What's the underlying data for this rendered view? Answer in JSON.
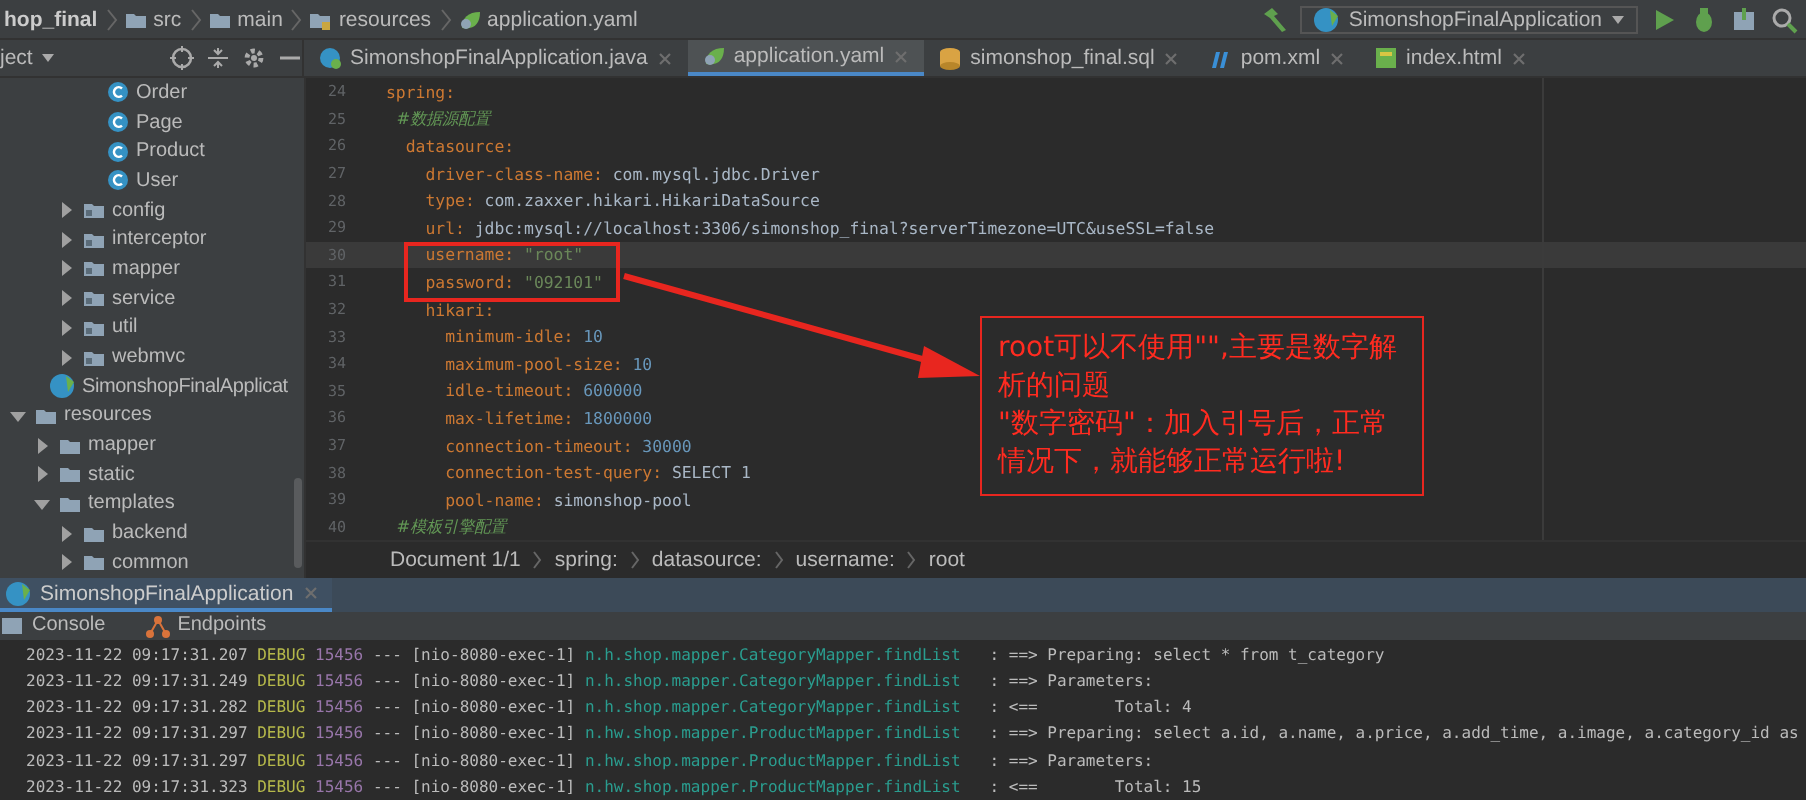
{
  "navbar": {
    "crumbs": [
      {
        "label": "hop_final",
        "kind": "project"
      },
      {
        "label": "src",
        "kind": "folder"
      },
      {
        "label": "main",
        "kind": "folder"
      },
      {
        "label": "resources",
        "kind": "resources"
      },
      {
        "label": "application.yaml",
        "kind": "yaml"
      }
    ],
    "run_config": "SimonshopFinalApplication"
  },
  "project_panel": {
    "title": "ject"
  },
  "tabs": [
    {
      "label": "SimonshopFinalApplication.java",
      "kind": "java",
      "selected": false
    },
    {
      "label": "application.yaml",
      "kind": "yaml",
      "selected": true
    },
    {
      "label": "simonshop_final.sql",
      "kind": "sql",
      "selected": false
    },
    {
      "label": "pom.xml",
      "kind": "pom",
      "selected": false
    },
    {
      "label": "index.html",
      "kind": "html",
      "selected": false
    }
  ],
  "tree": [
    {
      "label": "Order",
      "kind": "class"
    },
    {
      "label": "Page",
      "kind": "class"
    },
    {
      "label": "Product",
      "kind": "class"
    },
    {
      "label": "User",
      "kind": "class"
    },
    {
      "label": "config",
      "kind": "package",
      "expanded": false
    },
    {
      "label": "interceptor",
      "kind": "package",
      "expanded": false
    },
    {
      "label": "mapper",
      "kind": "package",
      "expanded": false
    },
    {
      "label": "service",
      "kind": "package",
      "expanded": false
    },
    {
      "label": "util",
      "kind": "package",
      "expanded": false
    },
    {
      "label": "webmvc",
      "kind": "package",
      "expanded": false
    },
    {
      "label": "SimonshopFinalApplicat",
      "kind": "app"
    },
    {
      "label": "resources",
      "kind": "folder",
      "expanded": true,
      "children": [
        {
          "label": "mapper",
          "kind": "folder",
          "expanded": false
        },
        {
          "label": "static",
          "kind": "folder",
          "expanded": false
        },
        {
          "label": "templates",
          "kind": "folder",
          "expanded": true,
          "children": [
            {
              "label": "backend",
              "kind": "folder",
              "expanded": false
            },
            {
              "label": "common",
              "kind": "folder",
              "expanded": false
            }
          ]
        }
      ]
    }
  ],
  "editor": {
    "lines": [
      {
        "number": "24",
        "current": false,
        "tokens": [
          {
            "kind": "key",
            "text": "spring"
          },
          {
            "kind": "punct",
            "text": ":"
          }
        ]
      },
      {
        "number": "25",
        "current": false,
        "tokens": [
          {
            "kind": "comment",
            "text": "  #数据源配置"
          }
        ]
      },
      {
        "number": "26",
        "current": false,
        "tokens": [
          {
            "kind": "key",
            "text": "  datasource"
          },
          {
            "kind": "punct",
            "text": ":"
          }
        ]
      },
      {
        "number": "27",
        "current": false,
        "tokens": [
          {
            "kind": "key",
            "text": "    driver-class-name"
          },
          {
            "kind": "punct",
            "text": ": "
          },
          {
            "kind": "plain",
            "text": "com.mysql.jdbc.Driver"
          }
        ]
      },
      {
        "number": "28",
        "current": false,
        "tokens": [
          {
            "kind": "key",
            "text": "    type"
          },
          {
            "kind": "punct",
            "text": ": "
          },
          {
            "kind": "plain",
            "text": "com.zaxxer.hikari.HikariDataSource"
          }
        ]
      },
      {
        "number": "29",
        "current": false,
        "tokens": [
          {
            "kind": "key",
            "text": "    url"
          },
          {
            "kind": "punct",
            "text": ": "
          },
          {
            "kind": "plain",
            "text": "jdbc:mysql://localhost:3306/simonshop_final?serverTimezone=UTC&useSSL=false"
          }
        ]
      },
      {
        "number": "30",
        "current": true,
        "tokens": [
          {
            "kind": "key",
            "text": "    username"
          },
          {
            "kind": "punct",
            "text": ": "
          },
          {
            "kind": "str",
            "text": "\"root\""
          }
        ]
      },
      {
        "number": "31",
        "current": false,
        "tokens": [
          {
            "kind": "key",
            "text": "    password"
          },
          {
            "kind": "punct",
            "text": ": "
          },
          {
            "kind": "str",
            "text": "\"092101\""
          }
        ]
      },
      {
        "number": "32",
        "current": false,
        "tokens": [
          {
            "kind": "key",
            "text": "    hikari"
          },
          {
            "kind": "punct",
            "text": ":"
          }
        ]
      },
      {
        "number": "33",
        "current": false,
        "tokens": [
          {
            "kind": "key",
            "text": "      minimum-idle"
          },
          {
            "kind": "punct",
            "text": ": "
          },
          {
            "kind": "num",
            "text": "10"
          }
        ]
      },
      {
        "number": "34",
        "current": false,
        "tokens": [
          {
            "kind": "key",
            "text": "      maximum-pool-size"
          },
          {
            "kind": "punct",
            "text": ": "
          },
          {
            "kind": "num",
            "text": "10"
          }
        ]
      },
      {
        "number": "35",
        "current": false,
        "tokens": [
          {
            "kind": "key",
            "text": "      idle-timeout"
          },
          {
            "kind": "punct",
            "text": ": "
          },
          {
            "kind": "num",
            "text": "600000"
          }
        ]
      },
      {
        "number": "36",
        "current": false,
        "tokens": [
          {
            "kind": "key",
            "text": "      max-lifetime"
          },
          {
            "kind": "punct",
            "text": ": "
          },
          {
            "kind": "num",
            "text": "1800000"
          }
        ]
      },
      {
        "number": "37",
        "current": false,
        "tokens": [
          {
            "kind": "key",
            "text": "      connection-timeout"
          },
          {
            "kind": "punct",
            "text": ": "
          },
          {
            "kind": "num",
            "text": "30000"
          }
        ]
      },
      {
        "number": "38",
        "current": false,
        "tokens": [
          {
            "kind": "key",
            "text": "      connection-test-query"
          },
          {
            "kind": "punct",
            "text": ": "
          },
          {
            "kind": "plain",
            "text": "SELECT 1"
          }
        ]
      },
      {
        "number": "39",
        "current": false,
        "tokens": [
          {
            "kind": "key",
            "text": "      pool-name"
          },
          {
            "kind": "punct",
            "text": ": "
          },
          {
            "kind": "plain",
            "text": "simonshop-pool"
          }
        ]
      },
      {
        "number": "40",
        "current": false,
        "tokens": [
          {
            "kind": "comment",
            "text": "  #模板引擎配置"
          }
        ]
      }
    ],
    "breadcrumbs": [
      "Document 1/1",
      "spring:",
      "datasource:",
      "username:",
      "root"
    ],
    "annotation": [
      "root可以不使用\"\",主要是数字解析的问题",
      "\"数字密码\"：加入引号后，正常情况下，就能够正常运行啦!"
    ]
  },
  "run_panel": {
    "tab": "SimonshopFinalApplication",
    "tools": [
      {
        "label": "Console",
        "kind": "console"
      },
      {
        "label": "Endpoints",
        "kind": "endpoints"
      }
    ],
    "log": [
      {
        "time": "2023-11-22 09:17:31.207",
        "level": "DEBUG",
        "pid": "15456",
        "sep": "---",
        "thread": "[nio-8080-exec-1]",
        "logger": "n.h.shop.mapper.CategoryMapper.findList",
        "arrow": ": ==>",
        "kind": "query",
        "message": "Preparing: select * from t_category"
      },
      {
        "time": "2023-11-22 09:17:31.249",
        "level": "DEBUG",
        "pid": "15456",
        "sep": "---",
        "thread": "[nio-8080-exec-1]",
        "logger": "n.h.shop.mapper.CategoryMapper.findList",
        "arrow": ": ==>",
        "kind": "params",
        "message": "Parameters:"
      },
      {
        "time": "2023-11-22 09:17:31.282",
        "level": "DEBUG",
        "pid": "15456",
        "sep": "---",
        "thread": "[nio-8080-exec-1]",
        "logger": "n.h.shop.mapper.CategoryMapper.findList",
        "arrow": ": <==",
        "kind": "result",
        "message": "Total: 4"
      },
      {
        "time": "2023-11-22 09:17:31.297",
        "level": "DEBUG",
        "pid": "15456",
        "sep": "---",
        "thread": "[nio-8080-exec-1]",
        "logger": "n.hw.shop.mapper.ProductMapper.findList",
        "arrow": ": ==>",
        "kind": "query",
        "message": "Preparing: select a.id, a.name, a.price, a.add_time, a.image, a.category_id as"
      },
      {
        "time": "2023-11-22 09:17:31.297",
        "level": "DEBUG",
        "pid": "15456",
        "sep": "---",
        "thread": "[nio-8080-exec-1]",
        "logger": "n.hw.shop.mapper.ProductMapper.findList",
        "arrow": ": ==>",
        "kind": "params",
        "message": "Parameters:"
      },
      {
        "time": "2023-11-22 09:17:31.323",
        "level": "DEBUG",
        "pid": "15456",
        "sep": "---",
        "thread": "[nio-8080-exec-1]",
        "logger": "n.hw.shop.mapper.ProductMapper.findList",
        "arrow": ": <==",
        "kind": "result",
        "message": "Total: 15"
      }
    ]
  }
}
